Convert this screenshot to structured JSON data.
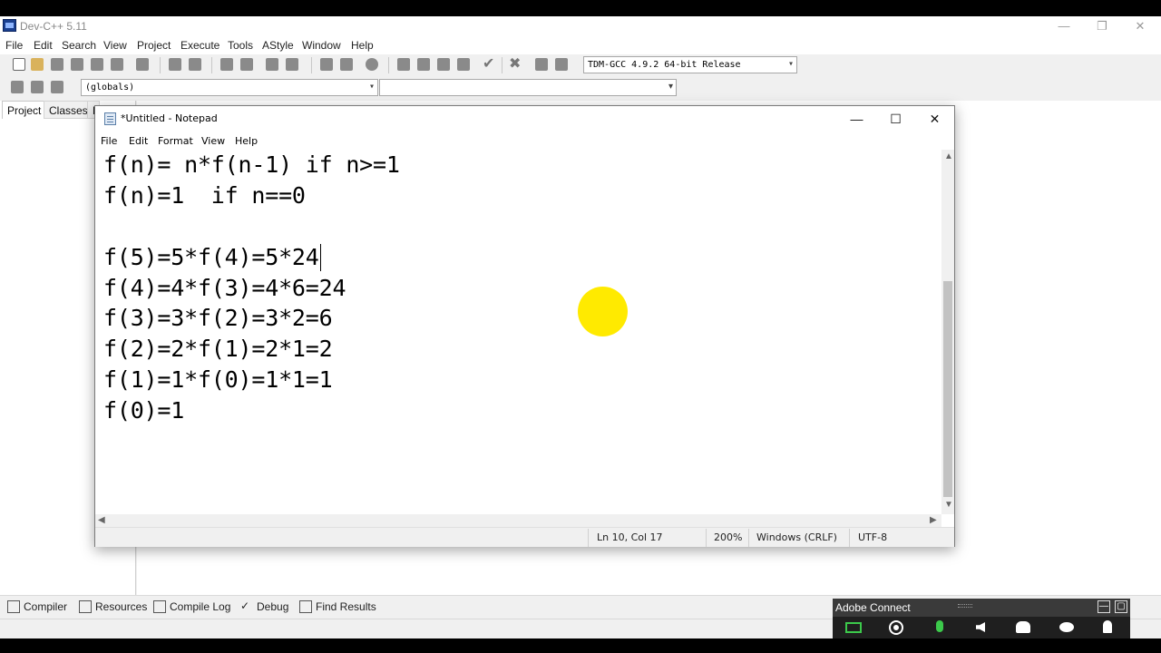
{
  "devcpp": {
    "title": "Dev-C++ 5.11",
    "window_controls": {
      "minimize": "—",
      "restore": "❐",
      "close": "✕"
    },
    "menu": [
      "File",
      "Edit",
      "Search",
      "View",
      "Project",
      "Execute",
      "Tools",
      "AStyle",
      "Window",
      "Help"
    ],
    "compiler": "TDM-GCC 4.9.2 64-bit Release",
    "scope": "(globals)",
    "members": "",
    "left_tabs": [
      "Project",
      "Classes",
      "Debug"
    ],
    "bottom_tabs": [
      "Compiler",
      "Resources",
      "Compile Log",
      "Debug",
      "Find Results"
    ]
  },
  "notepad": {
    "title": "*Untitled - Notepad",
    "window_controls": {
      "minimize": "—",
      "maximize": "☐",
      "close": "✕"
    },
    "menu": [
      "File",
      "Edit",
      "Format",
      "View",
      "Help"
    ],
    "lines": [
      "f(n)= n*f(n-1) if n>=1",
      "f(n)=1  if n==0",
      "",
      "f(5)=5*f(4)=5*24",
      "f(4)=4*f(3)=4*6=24",
      "f(3)=3*f(2)=3*2=6",
      "f(2)=2*f(1)=2*1=2",
      "f(1)=1*f(0)=1*1=1",
      "f(0)=1"
    ],
    "status": {
      "position": "Ln 10, Col 17",
      "zoom": "200%",
      "line_ending": "Windows (CRLF)",
      "encoding": "UTF-8"
    },
    "scroll_arrows": {
      "up": "▲",
      "down": "▼",
      "left": "◀",
      "right": "▶"
    }
  },
  "adobe_connect": {
    "title": "Adobe Connect",
    "header_buttons": {
      "minimize": "—",
      "maximize": "▢"
    },
    "icons": [
      "screen-share-icon",
      "camera-icon",
      "microphone-icon",
      "speaker-icon",
      "attendees-icon",
      "chat-icon",
      "raise-hand-icon"
    ]
  },
  "colors": {
    "highlight": "#ffea00",
    "mic_active": "#3cc94b",
    "share_active": "#3cc94b"
  }
}
